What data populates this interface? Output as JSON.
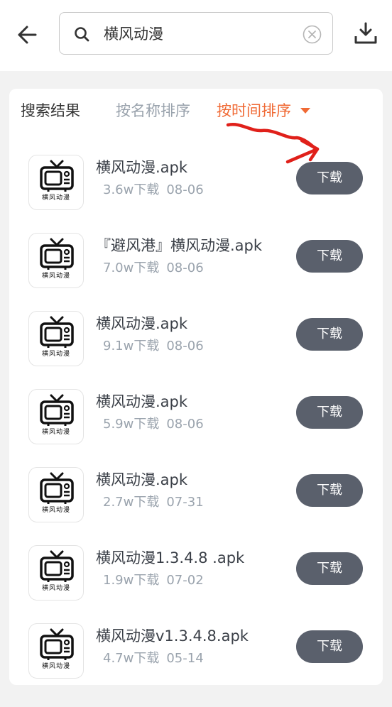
{
  "search": {
    "query": "横风动漫"
  },
  "tabs": {
    "results": "搜索结果",
    "sort_by_name": "按名称排序",
    "sort_by_time": "按时间排序"
  },
  "colors": {
    "accent": "#f06a35",
    "button": "#5a606c",
    "annotation": "#e0201a"
  },
  "icons": {
    "back": "arrow-left-icon",
    "search": "search-icon",
    "clear": "clear-icon",
    "download": "download-icon",
    "app": "tv-icon"
  },
  "download_label": "下载",
  "app_icon_text": "横风动漫",
  "results": [
    {
      "name": "横风动漫.apk",
      "downloads": "3.6w下载",
      "date": "08-06"
    },
    {
      "name": "『避风港』横风动漫.apk",
      "downloads": "7.0w下载",
      "date": "08-06"
    },
    {
      "name": "横风动漫.apk",
      "downloads": "9.1w下载",
      "date": "08-06"
    },
    {
      "name": "横风动漫.apk",
      "downloads": "5.9w下载",
      "date": "08-06"
    },
    {
      "name": "横风动漫.apk",
      "downloads": "2.7w下载",
      "date": "07-31"
    },
    {
      "name": "横风动漫1.3.4.8 .apk",
      "downloads": "1.9w下载",
      "date": "07-02"
    },
    {
      "name": "横风动漫v1.3.4.8.apk",
      "downloads": "4.7w下载",
      "date": "05-14"
    }
  ]
}
